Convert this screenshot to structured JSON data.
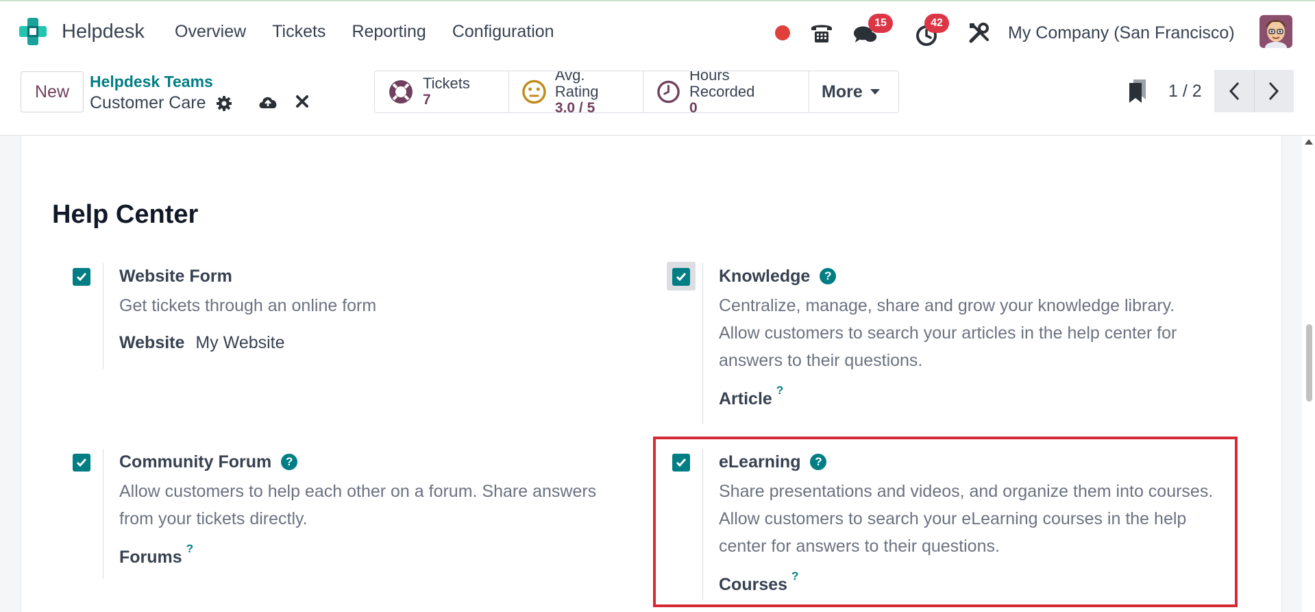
{
  "app": {
    "name": "Helpdesk",
    "logo_icon": "helpdesk-cross-icon",
    "brand_color": "#017e84",
    "accent_color": "#71405e"
  },
  "menu": [
    "Overview",
    "Tickets",
    "Reporting",
    "Configuration"
  ],
  "systray": {
    "messages_count": "15",
    "activities_count": "42",
    "company": "My Company (San Francisco)"
  },
  "control": {
    "new_label": "New",
    "breadcrumb_parent": "Helpdesk Teams",
    "breadcrumb_current": "Customer Care",
    "smart_buttons": [
      {
        "label": "Tickets",
        "value": "7",
        "icon": "lifebuoy-icon"
      },
      {
        "label": "Avg. Rating",
        "value": "3.0 / 5",
        "icon": "neutral-face-icon"
      },
      {
        "label": "Hours Recorded",
        "value": "0",
        "icon": "clock-icon"
      }
    ],
    "more_label": "More",
    "pager": "1 / 2"
  },
  "section": {
    "title": "Help Center",
    "settings": [
      {
        "title": "Website Form",
        "checked": true,
        "description": "Get tickets through an online form",
        "sub_label": "Website",
        "sub_value": "My Website"
      },
      {
        "title": "Knowledge",
        "checked": true,
        "description_lines": [
          "Centralize, manage, share and grow your knowledge library.",
          "Allow customers to search your articles in the help center for",
          "answers to their questions."
        ],
        "sub_label": "Article",
        "sub_help": "?"
      },
      {
        "title": "Community Forum",
        "checked": true,
        "description_lines": [
          "Allow customers to help each other on a forum. Share answers",
          "from your tickets directly."
        ],
        "sub_label": "Forums",
        "sub_help": "?"
      },
      {
        "title": "eLearning",
        "checked": true,
        "description_lines": [
          "Share presentations and videos, and organize them into courses.",
          "Allow customers to search your eLearning courses in the help",
          "center for answers to their questions."
        ],
        "sub_label": "Courses",
        "sub_help": "?"
      }
    ]
  }
}
